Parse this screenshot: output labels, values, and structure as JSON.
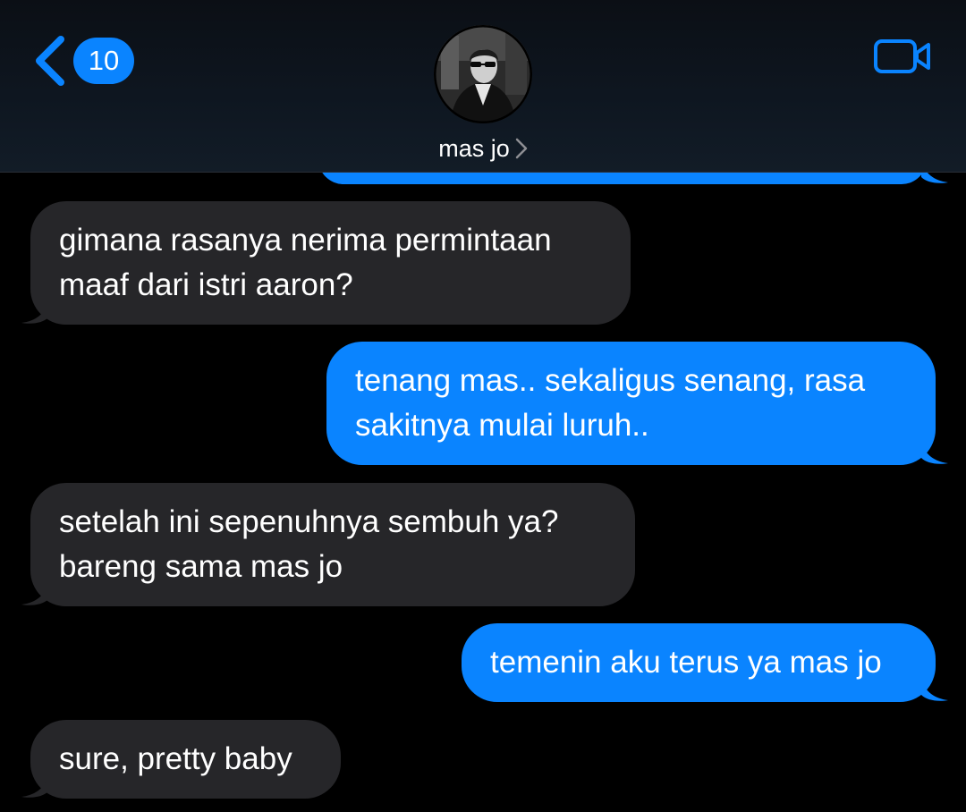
{
  "header": {
    "back_badge_count": "10",
    "contact_name": "mas jo"
  },
  "colors": {
    "accent": "#0a84ff",
    "received_bubble": "#262629",
    "background": "#000000"
  },
  "icons": {
    "back": "chevron-left-icon",
    "contact_detail": "chevron-right-icon",
    "video_call": "video-camera-icon"
  },
  "messages": [
    {
      "direction": "received",
      "lines": [
        "gimana rasanya nerima permintaan",
        "maaf dari istri aaron?"
      ]
    },
    {
      "direction": "sent",
      "lines": [
        "tenang mas.. sekaligus senang, rasa",
        "sakitnya mulai luruh.."
      ]
    },
    {
      "direction": "received",
      "lines": [
        "setelah ini sepenuhnya sembuh ya?",
        "bareng sama mas jo"
      ]
    },
    {
      "direction": "sent",
      "lines": [
        "temenin aku terus ya mas jo"
      ]
    },
    {
      "direction": "received",
      "lines": [
        "sure, pretty baby"
      ]
    }
  ]
}
